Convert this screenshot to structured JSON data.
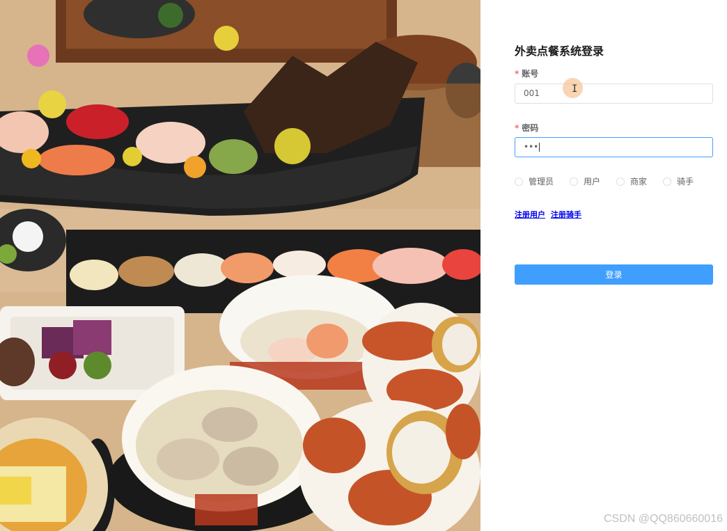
{
  "login": {
    "title": "外卖点餐系统登录",
    "account_label": "账号",
    "account_value": "001",
    "password_label": "密码",
    "password_value": "•••",
    "roles": [
      "管理员",
      "用户",
      "商家",
      "骑手"
    ],
    "register_user": "注册用户",
    "register_rider": "注册骑手",
    "login_button": "登录"
  },
  "watermark": "CSDN @QQ860660016",
  "colors": {
    "primary": "#409eff",
    "required": "#f56c6c",
    "link": "#0000ee"
  }
}
